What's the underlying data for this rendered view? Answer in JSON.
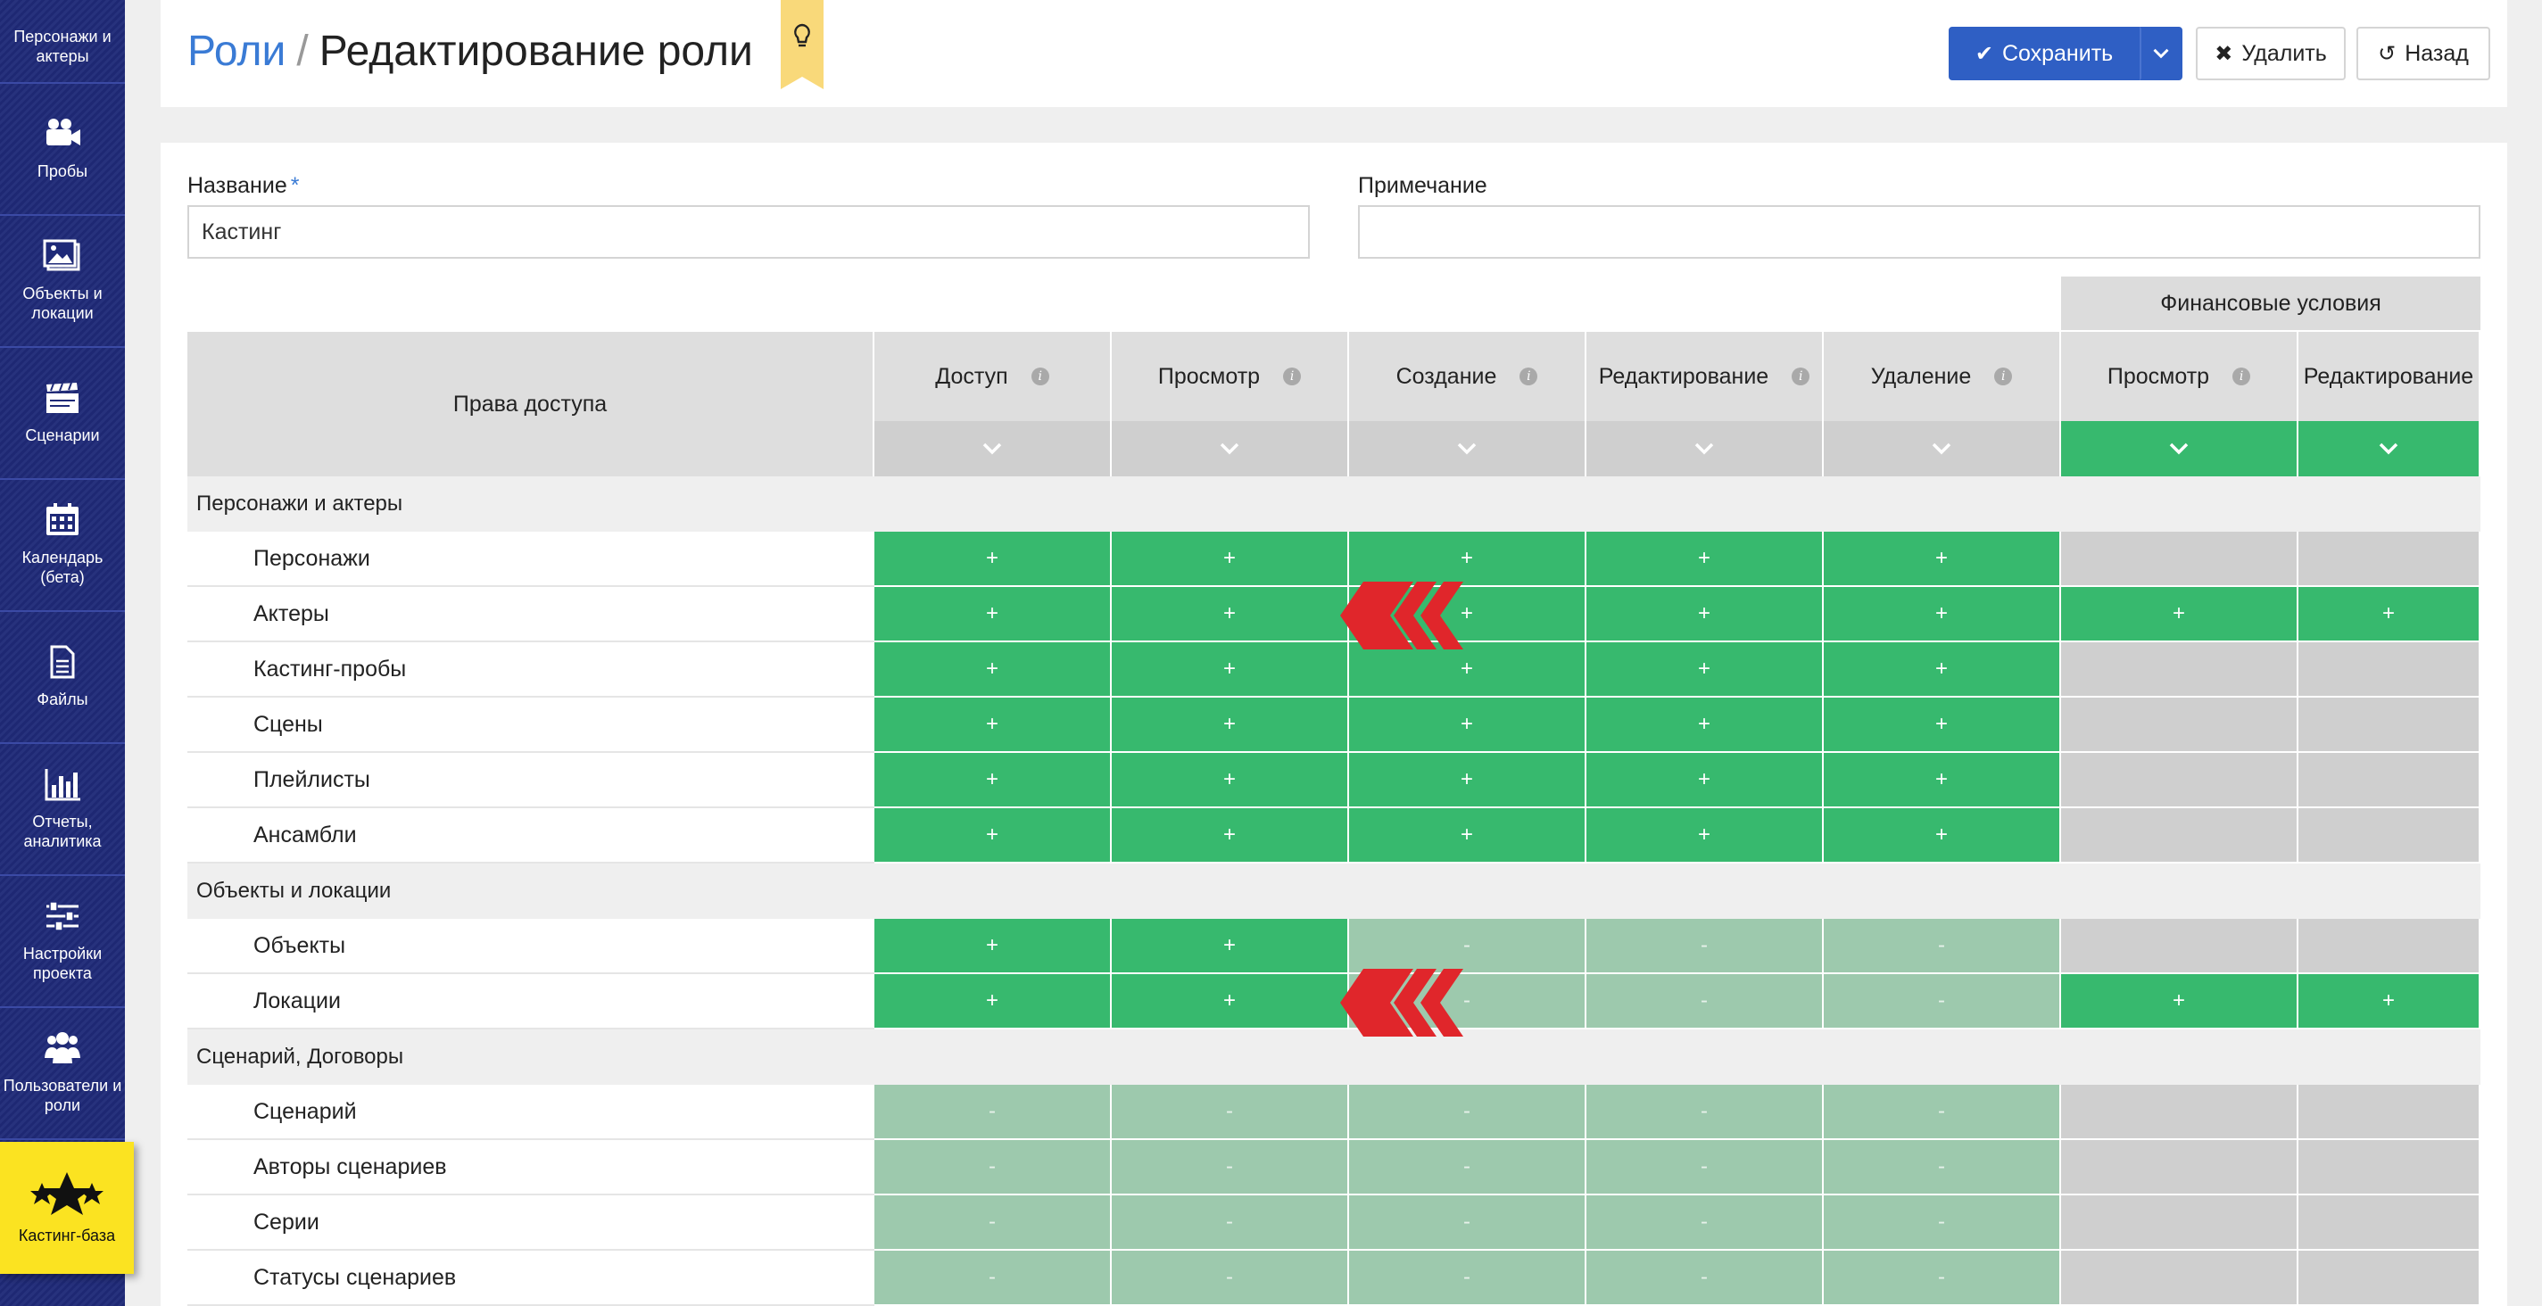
{
  "sidebar": {
    "items": [
      {
        "label": "Персонажи и актеры",
        "icon": "person-icon"
      },
      {
        "label": "Пробы",
        "icon": "video-camera-icon"
      },
      {
        "label": "Объекты и локации",
        "icon": "image-icon"
      },
      {
        "label": "Сценарии",
        "icon": "clapperboard-icon"
      },
      {
        "label": "Календарь (бета)",
        "icon": "calendar-icon"
      },
      {
        "label": "Файлы",
        "icon": "file-icon"
      },
      {
        "label": "Отчеты, аналитика",
        "icon": "bar-chart-icon"
      },
      {
        "label": "Настройки проекта",
        "icon": "sliders-icon"
      },
      {
        "label": "Пользователи и роли",
        "icon": "users-icon"
      },
      {
        "label": "Кастинг-база",
        "icon": "stars-icon",
        "active": true
      }
    ]
  },
  "header": {
    "breadcrumb_link": "Роли",
    "separator": "/",
    "title": "Редактирование роли",
    "save_label": "Сохранить",
    "delete_label": "Удалить",
    "back_label": "Назад"
  },
  "form": {
    "name_label": "Название",
    "name_required": "*",
    "name_value": "Кастинг",
    "note_label": "Примечание",
    "note_value": ""
  },
  "table": {
    "rights_header": "Права доступа",
    "finance_header": "Финансовые условия",
    "columns": [
      "Доступ",
      "Просмотр",
      "Создание",
      "Редактирование",
      "Удаление",
      "Просмотр",
      "Редактирование"
    ],
    "groups": [
      {
        "label": "Персонажи и актеры",
        "rows": [
          {
            "label": "Персонажи",
            "cells": [
              "+",
              "+",
              "+",
              "+",
              "+",
              "",
              ""
            ]
          },
          {
            "label": "Актеры",
            "cells": [
              "+",
              "+",
              "+",
              "+",
              "+",
              "+",
              "+"
            ]
          },
          {
            "label": "Кастинг-пробы",
            "cells": [
              "+",
              "+",
              "+",
              "+",
              "+",
              "",
              ""
            ]
          },
          {
            "label": "Сцены",
            "cells": [
              "+",
              "+",
              "+",
              "+",
              "+",
              "",
              ""
            ]
          },
          {
            "label": "Плейлисты",
            "cells": [
              "+",
              "+",
              "+",
              "+",
              "+",
              "",
              ""
            ]
          },
          {
            "label": "Ансамбли",
            "cells": [
              "+",
              "+",
              "+",
              "+",
              "+",
              "",
              ""
            ]
          }
        ]
      },
      {
        "label": "Объекты и локации",
        "rows": [
          {
            "label": "Объекты",
            "cells": [
              "+",
              "+",
              "-",
              "-",
              "-",
              "",
              ""
            ]
          },
          {
            "label": "Локации",
            "cells": [
              "+",
              "+",
              "-",
              "-",
              "-",
              "+",
              "+"
            ]
          }
        ]
      },
      {
        "label": "Сценарий, Договоры",
        "rows": [
          {
            "label": "Сценарий",
            "cells": [
              "-",
              "-",
              "-",
              "-",
              "-",
              "",
              ""
            ]
          },
          {
            "label": "Авторы сценариев",
            "cells": [
              "-",
              "-",
              "-",
              "-",
              "-",
              "",
              ""
            ]
          },
          {
            "label": "Серии",
            "cells": [
              "-",
              "-",
              "-",
              "-",
              "-",
              "",
              ""
            ]
          },
          {
            "label": "Статусы сценариев",
            "cells": [
              "-",
              "-",
              "-",
              "-",
              "-",
              "",
              ""
            ]
          }
        ]
      }
    ]
  }
}
